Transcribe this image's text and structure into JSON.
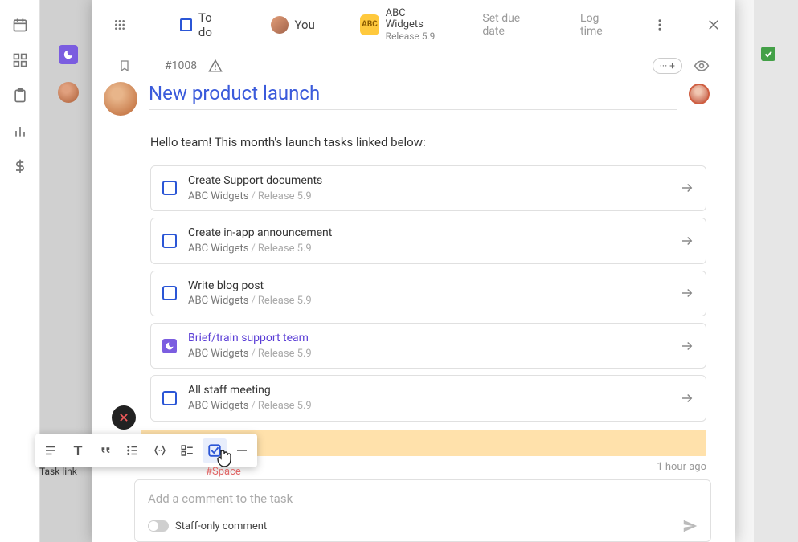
{
  "header": {
    "status_label": "To do",
    "assignee_label": "You",
    "project_badge": "ABC",
    "project_name": "ABC Widgets",
    "project_sub": "Release 5.9",
    "set_due_date": "Set due date",
    "log_time": "Log time"
  },
  "meta": {
    "task_number": "#1008",
    "pill_label": "··· +"
  },
  "title": "New product launch",
  "body": "Hello team! This month's launch tasks linked below:",
  "linked_tasks": [
    {
      "title": "Create Support documents",
      "project": "ABC Widgets",
      "release": "Release 5.9",
      "style": "blue"
    },
    {
      "title": "Create in-app announcement",
      "project": "ABC Widgets",
      "release": "Release 5.9",
      "style": "blue"
    },
    {
      "title": "Write blog post",
      "project": "ABC Widgets",
      "release": "Release 5.9",
      "style": "blue"
    },
    {
      "title": "Brief/train support team",
      "project": "ABC Widgets",
      "release": "Release 5.9",
      "style": "purple"
    },
    {
      "title": "All staff meeting",
      "project": "ABC Widgets",
      "release": "Release 5.9",
      "style": "blue"
    }
  ],
  "timestamp": "1 hour ago",
  "comment": {
    "placeholder": "Add a comment to the task",
    "staff_only_label": "Staff-only comment"
  },
  "toolbar": {
    "tooltip": "Task link",
    "shortcut": "#Space"
  }
}
